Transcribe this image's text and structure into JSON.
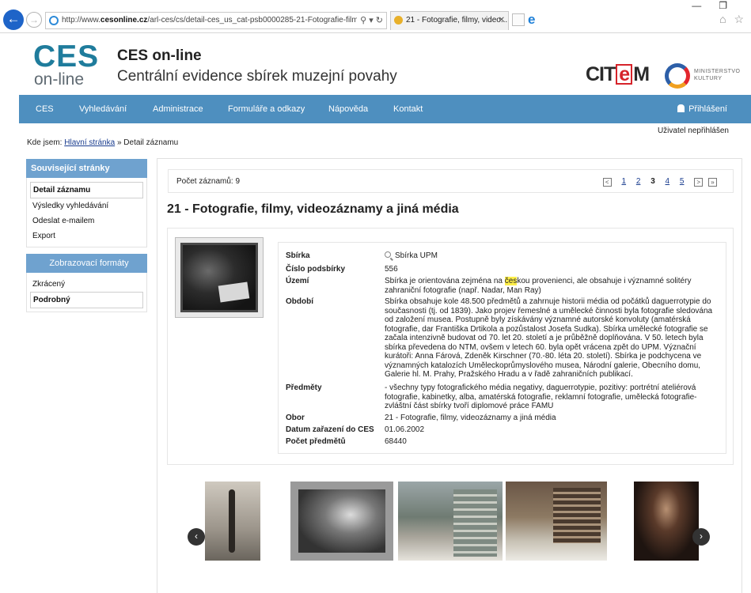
{
  "browser": {
    "url_prefix": "http://www.",
    "url_domain": "cesonline.cz",
    "url_rest": "/arl-ces/cs/detail-ces_us_cat-psb0000285-21-Fotografie-filmy-videc",
    "tab_title": "21 - Fotografie, filmy, video...",
    "back_icon": "arrow-left-icon",
    "forward_icon": "arrow-right-icon"
  },
  "header": {
    "logo_main": "CES",
    "logo_sub": "on-line",
    "title": "CES on-line",
    "subtitle": "Centrální evidence sbírek muzejní povahy",
    "citem_left": "CIT",
    "citem_e": "e",
    "citem_right": "M",
    "ministry_line1": "MINISTERSTVO",
    "ministry_line2": "KULTURY"
  },
  "nav": {
    "items": [
      "CES",
      "Vyhledávání",
      "Administrace",
      "Formuláře a odkazy",
      "Nápověda",
      "Kontakt"
    ],
    "login": "Přihlášení"
  },
  "user_status": "Uživatel nepřihlášen",
  "breadcrumb": {
    "prefix": "Kde jsem:",
    "home": "Hlavní stránka",
    "sep": "»",
    "current": "Detail záznamu"
  },
  "sidebar": {
    "related_title": "Související stránky",
    "related_items": [
      "Detail záznamu",
      "Výsledky vyhledávání",
      "Odeslat e-mailem",
      "Export"
    ],
    "formats_title": "Zobrazovací formáty",
    "format_items": [
      "Zkrácený",
      "Podrobný"
    ]
  },
  "results": {
    "count_label": "Počet záznamů: 9",
    "pages": [
      "1",
      "2",
      "3",
      "4",
      "5"
    ],
    "current_page": "3"
  },
  "record": {
    "title": "21 - Fotografie, filmy, videozáznamy a jiná média",
    "fields": [
      {
        "label": "Sbírka",
        "value": "Sbírka UPM"
      },
      {
        "label": "Číslo podsbírky",
        "value": "556"
      },
      {
        "label": "Území",
        "value_before": "Sbírka je orientována zejména na ",
        "value_hl": "čes",
        "value_after": "kou provenienci, ale obsahuje i významné solitéry zahraniční fotografie (např. Nadar, Man Ray)"
      },
      {
        "label": "Období",
        "value": "Sbírka obsahuje kole 48.500 předmětů a zahrnuje historii média od počátků daguerrotypie do současnosti (tj. od 1839). Jako projev řemeslné a umělecké činnosti byla fotografie sledována od založení musea. Postupně byly získávány významné autorské konvoluty (amatérská fotografie, dar Františka Drtikola a pozůstalost Josefa Sudka). Sbírka umělecké fotografie se začala intenzivně budovat od 70. let 20. století a je průběžně doplňována. V 50. letech byla sbírka převedena do NTM, ovšem v letech 60. byla opět vrácena zpět do UPM. Význační kurátoři: Anna Fárová, Zdeněk Kirschner (70.-80. léta 20. století). Sbírka je podchycena ve významných katalozích Uměleckoprůmyslového musea, Národní galerie, Obecního domu, Galerie hl. M. Prahy, Pražského Hradu a v řadě zahraničních publikací."
      },
      {
        "label": "Předměty",
        "value": "- všechny typy fotografického média negativy, daguerrotypie, pozitivy: portrétní ateliérová fotografie, kabinetky, alba, amatérská fotografie, reklamní fotografie, umělecká fotografie- zvláštní část sbírky tvoří diplomové práce FAMU"
      },
      {
        "label": "Obor",
        "value": "21 - Fotografie, filmy, videozáznamy a jiná média"
      },
      {
        "label": "Datum zařazení do CES",
        "value": "01.06.2002"
      },
      {
        "label": "Počet předmětů",
        "value": "68440"
      }
    ]
  },
  "gallery": {
    "prev": "‹",
    "next": "›"
  }
}
